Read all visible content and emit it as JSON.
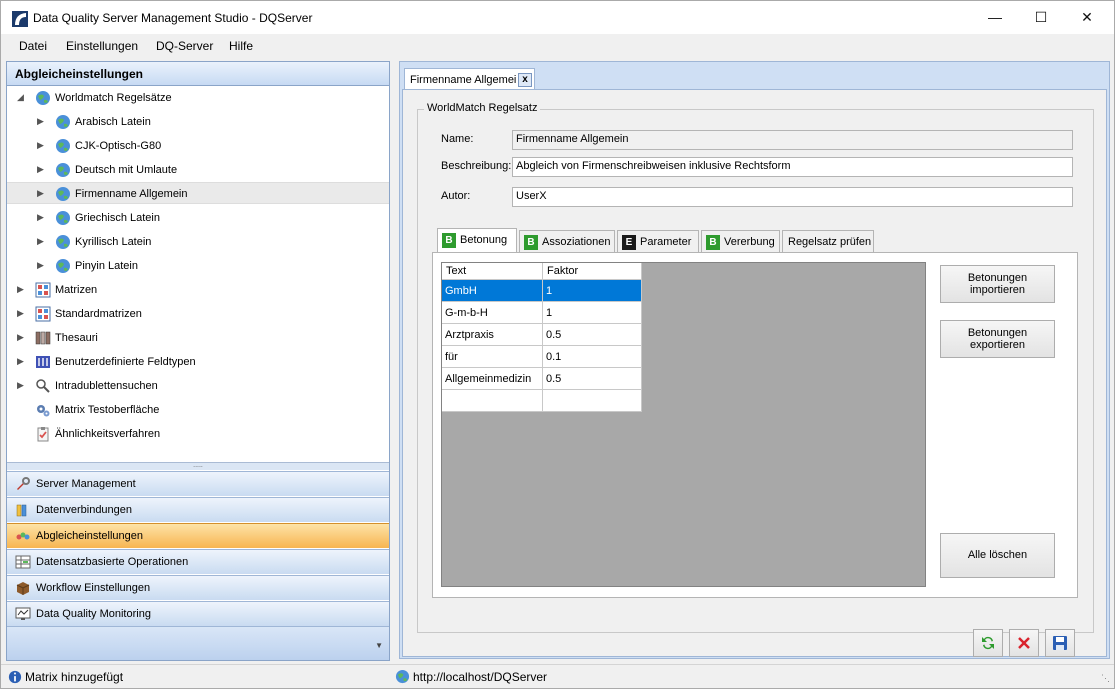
{
  "window": {
    "title": "Data Quality Server Management Studio - DQServer"
  },
  "menu": [
    "Datei",
    "Einstellungen",
    "DQ-Server",
    "Hilfe"
  ],
  "left": {
    "header": "Abgleicheinstellungen",
    "tree": [
      {
        "label": "Worldmatch Regelsätze",
        "icon": "globe-icon",
        "expanded": true
      },
      {
        "label": "Arabisch Latein",
        "icon": "globe-icon"
      },
      {
        "label": "CJK-Optisch-G80",
        "icon": "globe-icon"
      },
      {
        "label": "Deutsch mit Umlaute",
        "icon": "globe-icon"
      },
      {
        "label": "Firmenname Allgemein",
        "icon": "globe-icon",
        "selected": true
      },
      {
        "label": "Griechisch Latein",
        "icon": "globe-icon"
      },
      {
        "label": "Kyrillisch Latein",
        "icon": "globe-icon"
      },
      {
        "label": "Pinyin Latein",
        "icon": "globe-icon"
      },
      {
        "label": "Matrizen",
        "icon": "matrix-icon"
      },
      {
        "label": "Standardmatrizen",
        "icon": "matrix-icon"
      },
      {
        "label": "Thesauri",
        "icon": "books-icon"
      },
      {
        "label": "Benutzerdefinierte Feldtypen",
        "icon": "columns-icon"
      },
      {
        "label": "Intradublettensuchen",
        "icon": "magnifier-icon"
      },
      {
        "label": "Matrix Testoberfläche",
        "icon": "gears-icon"
      },
      {
        "label": "Ähnlichkeitsverfahren",
        "icon": "clipboard-icon"
      }
    ],
    "nav": [
      {
        "label": "Server Management",
        "icon": "wrench-icon"
      },
      {
        "label": "Datenverbindungen",
        "icon": "database-icon"
      },
      {
        "label": "Abgleicheinstellungen",
        "icon": "settings-icon",
        "active": true
      },
      {
        "label": "Datensatzbasierte Operationen",
        "icon": "records-icon"
      },
      {
        "label": "Workflow Einstellungen",
        "icon": "box-icon"
      },
      {
        "label": "Data Quality Monitoring",
        "icon": "monitor-icon"
      }
    ]
  },
  "doc_tab": {
    "label": "Firmenname Allgemein",
    "close": "x"
  },
  "group": {
    "title": "WorldMatch Regelsatz",
    "name_label": "Name:",
    "name_value": "Firmenname Allgemein",
    "desc_label": "Beschreibung:",
    "desc_value": "Abgleich von Firmenschreibweisen inklusive Rechtsform",
    "author_label": "Autor:",
    "author_value": "UserX"
  },
  "tabs": [
    {
      "badge": "B",
      "label": "Betonung",
      "badge_color": "#2e9b2e",
      "active": true
    },
    {
      "badge": "B",
      "label": "Assoziationen",
      "badge_color": "#2e9b2e"
    },
    {
      "badge": "E",
      "label": "Parameter",
      "badge_color": "#1a1a1a"
    },
    {
      "badge": "B",
      "label": "Vererbung",
      "badge_color": "#2e9b2e"
    },
    {
      "badge": "",
      "label": "Regelsatz prüfen"
    }
  ],
  "grid": {
    "headers": [
      "Text",
      "Faktor"
    ],
    "rows": [
      [
        "GmbH",
        "1"
      ],
      [
        "G-m-b-H",
        "1"
      ],
      [
        "Arztpraxis",
        "0.5"
      ],
      [
        "für",
        "0.1"
      ],
      [
        "Allgemeinmedizin",
        "0.5"
      ],
      [
        "",
        ""
      ]
    ]
  },
  "buttons": {
    "import_1": "Betonungen",
    "import_2": "importieren",
    "export_1": "Betonungen",
    "export_2": "exportieren",
    "clear": "Alle löschen"
  },
  "status": {
    "left": "Matrix hinzugefügt",
    "url": "http://localhost/DQServer"
  }
}
